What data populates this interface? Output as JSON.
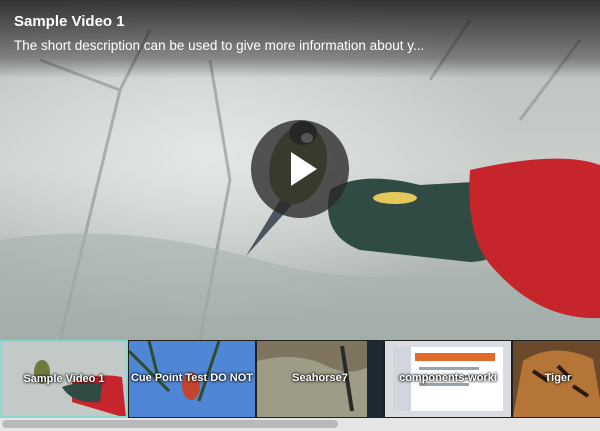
{
  "video": {
    "title": "Sample Video 1",
    "description": "The short description can be used to give more information about y..."
  },
  "controls": {
    "play_icon": "play-icon"
  },
  "playlist": [
    {
      "label": "Sample Video 1",
      "active": true
    },
    {
      "label": "Cue Point Test DO NOT",
      "active": false
    },
    {
      "label": "Seahorse7",
      "active": false
    },
    {
      "label": "components-worki",
      "active": false
    },
    {
      "label": "Tiger",
      "active": false
    }
  ],
  "colors": {
    "active_border": "#8cd5cb",
    "strip_bg": "#202020"
  }
}
